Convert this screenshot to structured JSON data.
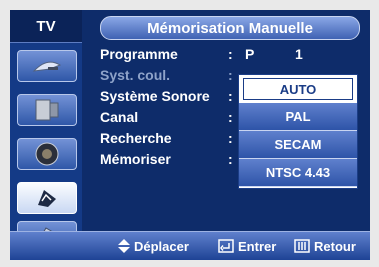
{
  "side": {
    "tab_label": "TV",
    "icons": [
      "satellite-dish-icon",
      "picture-icon",
      "speaker-icon",
      "channel-icon",
      "feature-icon"
    ]
  },
  "header": {
    "title": "Mémorisation Manuelle"
  },
  "menu": {
    "rows": [
      {
        "label": "Programme",
        "colon": ":",
        "value": "P",
        "value2": "1"
      },
      {
        "label": "Syst. coul.",
        "colon": ":",
        "value": "",
        "value2": ""
      },
      {
        "label": "Système Sonore",
        "colon": ":",
        "value": "",
        "value2": ""
      },
      {
        "label": "Canal",
        "colon": ":",
        "value": "",
        "value2": ""
      },
      {
        "label": "Recherche",
        "colon": ":",
        "value": "",
        "value2": ""
      },
      {
        "label": "Mémoriser",
        "colon": ":",
        "value": "",
        "value2": ""
      }
    ]
  },
  "dropdown": {
    "options": [
      "AUTO",
      "PAL",
      "SECAM",
      "NTSC 4.43"
    ],
    "selected": "AUTO"
  },
  "footer": {
    "move_label": "Déplacer",
    "enter_label": "Entrer",
    "return_label": "Retour"
  },
  "colors": {
    "screen_bg": "#0e2c6a",
    "highlight": "#ffffff",
    "accent": "#3f62b3"
  }
}
